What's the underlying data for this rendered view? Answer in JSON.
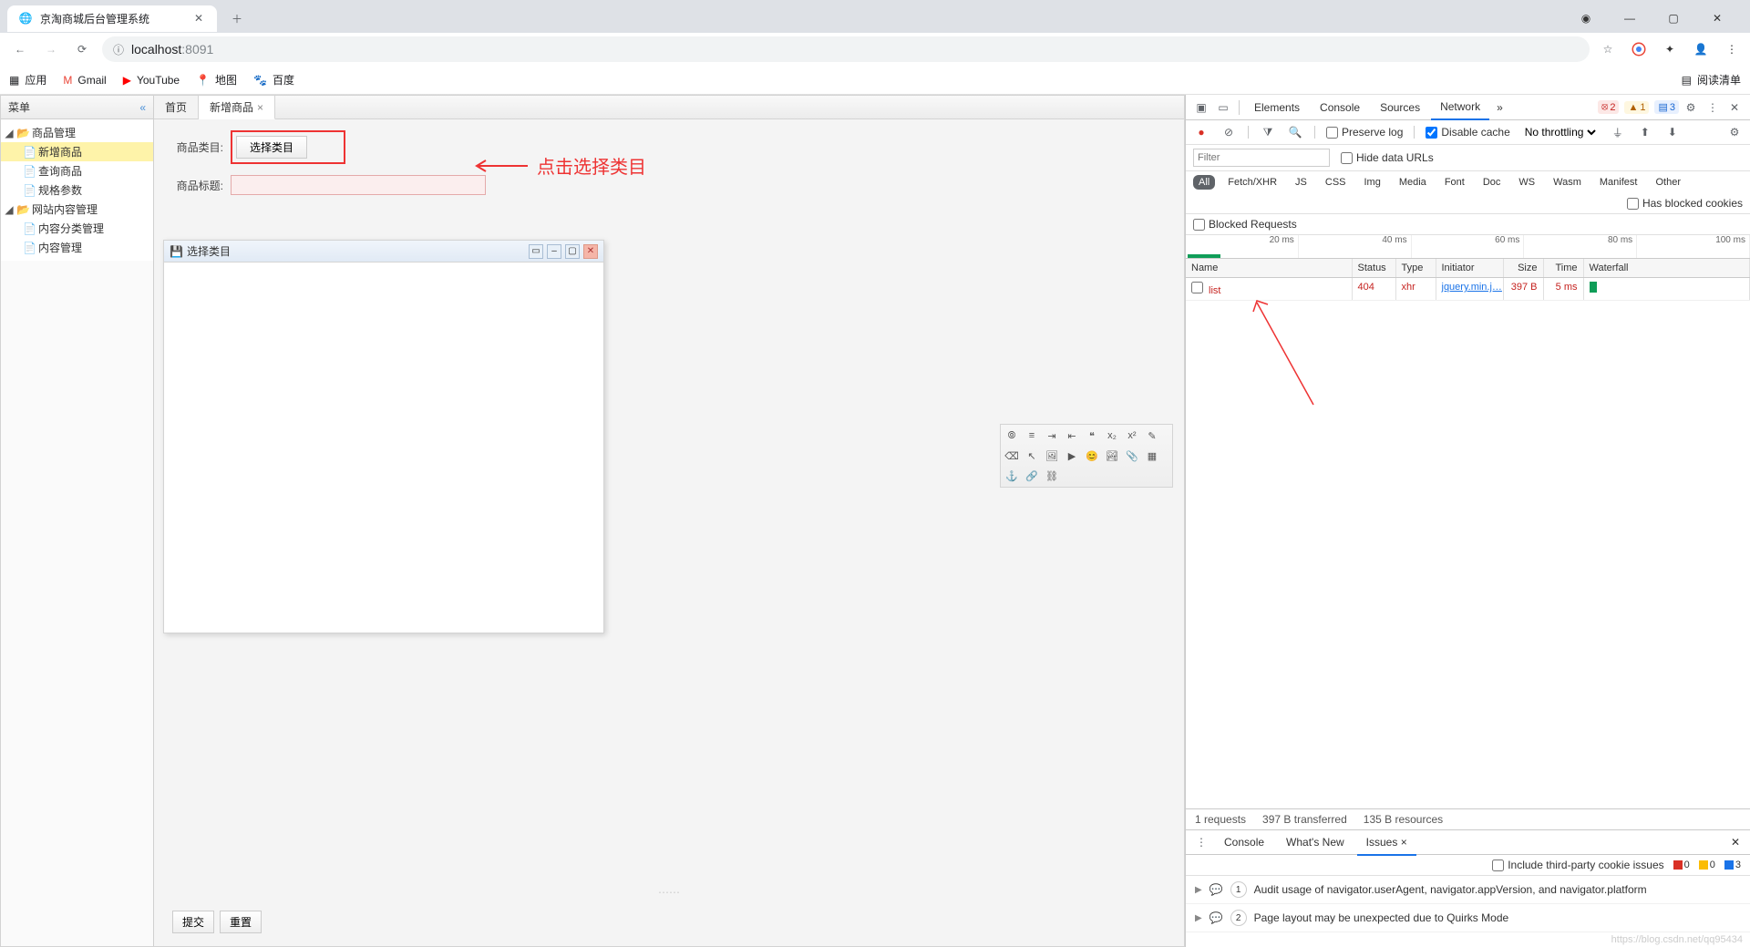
{
  "browser": {
    "tab_title": "京淘商城后台管理系统",
    "url_host": "localhost",
    "url_port": ":8091",
    "reading_list": "阅读清单",
    "bookmarks": [
      "应用",
      "Gmail",
      "YouTube",
      "地图",
      "百度"
    ]
  },
  "sidebar": {
    "header": "菜单",
    "nodes": [
      {
        "label": "商品管理",
        "type": "folder",
        "level": 1,
        "expanded": true
      },
      {
        "label": "新增商品",
        "type": "file",
        "level": 2,
        "active": true
      },
      {
        "label": "查询商品",
        "type": "file",
        "level": 2
      },
      {
        "label": "规格参数",
        "type": "file",
        "level": 2
      },
      {
        "label": "网站内容管理",
        "type": "folder",
        "level": 1,
        "expanded": true
      },
      {
        "label": "内容分类管理",
        "type": "file",
        "level": 2
      },
      {
        "label": "内容管理",
        "type": "file",
        "level": 2
      }
    ]
  },
  "content": {
    "tabs": [
      {
        "label": "首页",
        "closable": false,
        "active": false
      },
      {
        "label": "新增商品",
        "closable": true,
        "active": true
      }
    ],
    "form": {
      "category_label": "商品类目:",
      "category_button": "选择类目",
      "title_label": "商品标题:"
    },
    "annotation_text": "点击选择类目",
    "dialog_title": "选择类目",
    "submit": "提交",
    "reset": "重置"
  },
  "devtools": {
    "tabs": [
      "Elements",
      "Console",
      "Sources",
      "Network"
    ],
    "active_tab": "Network",
    "badges": {
      "errors": "2",
      "warnings": "1",
      "info": "3"
    },
    "toolbar": {
      "preserve_log": "Preserve log",
      "disable_cache": "Disable cache",
      "throttling": "No throttling"
    },
    "filter_placeholder": "Filter",
    "hide_data_urls": "Hide data URLs",
    "types": [
      "All",
      "Fetch/XHR",
      "JS",
      "CSS",
      "Img",
      "Media",
      "Font",
      "Doc",
      "WS",
      "Wasm",
      "Manifest",
      "Other"
    ],
    "active_type": "All",
    "has_blocked_cookies": "Has blocked cookies",
    "blocked_requests": "Blocked Requests",
    "timeline_ticks": [
      "20 ms",
      "40 ms",
      "60 ms",
      "80 ms",
      "100 ms"
    ],
    "columns": [
      "Name",
      "Status",
      "Type",
      "Initiator",
      "Size",
      "Time",
      "Waterfall"
    ],
    "row": {
      "name": "list",
      "status": "404",
      "type": "xhr",
      "initiator": "jquery.min.j…",
      "size": "397 B",
      "time": "5 ms"
    },
    "status_bar": {
      "requests": "1 requests",
      "transferred": "397 B transferred",
      "resources": "135 B resources"
    },
    "drawer": {
      "tabs": [
        "Console",
        "What's New",
        "Issues"
      ],
      "active": "Issues",
      "include_third_party": "Include third-party cookie issues",
      "sev_counts": {
        "red": "0",
        "yellow": "0",
        "blue": "3"
      },
      "issues": [
        {
          "n": "1",
          "text": "Audit usage of navigator.userAgent, navigator.appVersion, and navigator.platform"
        },
        {
          "n": "2",
          "text": "Page layout may be unexpected due to Quirks Mode"
        }
      ]
    }
  },
  "watermark": "https://blog.csdn.net/qq95434"
}
